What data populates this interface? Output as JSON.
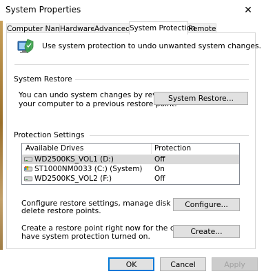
{
  "window": {
    "title": "System Properties",
    "close_glyph": "✕"
  },
  "tabs": [
    {
      "label": "Computer Name",
      "active": false
    },
    {
      "label": "Hardware",
      "active": false
    },
    {
      "label": "Advanced",
      "active": false
    },
    {
      "label": "System Protection",
      "active": true
    },
    {
      "label": "Remote",
      "active": false
    }
  ],
  "intro": {
    "icon": "system-protection-icon",
    "text": "Use system protection to undo unwanted system changes."
  },
  "system_restore": {
    "heading": "System Restore",
    "description_line1": "You can undo system changes by reverting",
    "description_line2": "your computer to a previous restore point.",
    "button": "System Restore..."
  },
  "protection_settings": {
    "heading": "Protection Settings",
    "columns": [
      "Available Drives",
      "Protection"
    ],
    "drives": [
      {
        "name": "WD2500KS_VOL1 (D:)",
        "protection": "Off",
        "icon": "drive-icon",
        "selected": true
      },
      {
        "name": "ST1000NM0033 (C:) (System)",
        "protection": "On",
        "icon": "system-drive-icon",
        "selected": false
      },
      {
        "name": "WD2500KS_VOL2 (F:)",
        "protection": "Off",
        "icon": "drive-icon",
        "selected": false
      }
    ],
    "configure_text_line1": "Configure restore settings, manage disk space, and",
    "configure_text_line2": "delete restore points.",
    "configure_button": "Configure...",
    "create_text_line1": "Create a restore point right now for the drives that",
    "create_text_line2": "have system protection turned on.",
    "create_button": "Create..."
  },
  "footer": {
    "ok": "OK",
    "cancel": "Cancel",
    "apply": "Apply"
  },
  "colors": {
    "accent": "#0078d7",
    "button_face": "#e1e1e1",
    "selected_row": "#d9d9d9"
  }
}
